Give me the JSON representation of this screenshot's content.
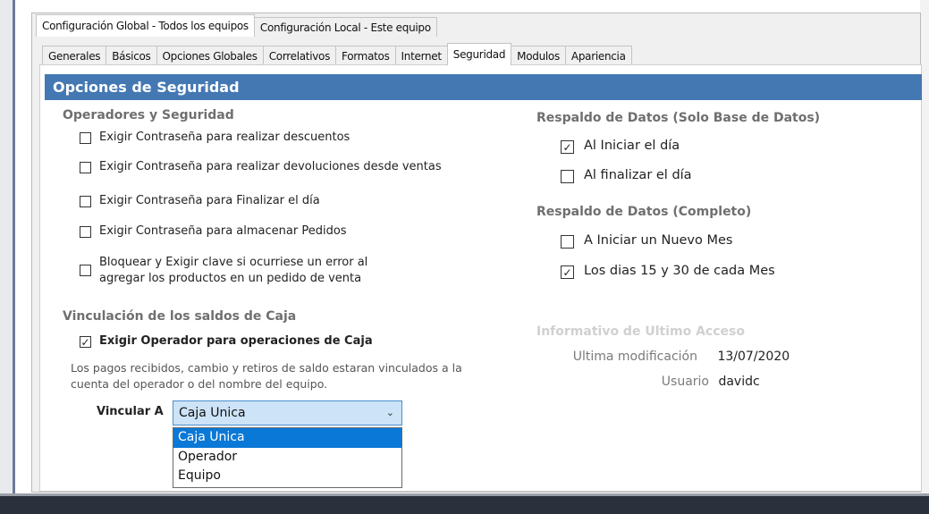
{
  "top_tabs": [
    {
      "label": "Configuración Global - Todos los equipos",
      "active": true
    },
    {
      "label": "Configuración Local - Este equipo",
      "active": false
    }
  ],
  "sub_tabs": [
    {
      "label": "Generales",
      "active": false
    },
    {
      "label": "Básicos",
      "active": false
    },
    {
      "label": "Opciones Globales",
      "active": false
    },
    {
      "label": "Correlativos",
      "active": false
    },
    {
      "label": "Formatos",
      "active": false
    },
    {
      "label": "Internet",
      "active": false
    },
    {
      "label": "Seguridad",
      "active": true
    },
    {
      "label": "Modulos",
      "active": false
    },
    {
      "label": "Apariencia",
      "active": false
    }
  ],
  "section_title": "Opciones de Seguridad",
  "operadores": {
    "title": "Operadores y Seguridad",
    "items": [
      {
        "label": "Exigir Contraseña para realizar descuentos",
        "checked": false
      },
      {
        "label": "Exigir Contraseña para realizar devoluciones desde ventas",
        "checked": false
      },
      {
        "label": "Exigir Contraseña para Finalizar el día",
        "checked": false
      },
      {
        "label": "Exigir Contraseña para almacenar Pedidos",
        "checked": false
      },
      {
        "label": "Bloquear y Exigir clave si ocurriese un error al agregar los productos en un pedido de venta",
        "checked": false
      }
    ]
  },
  "vinculacion": {
    "title": "Vinculación de los saldos de Caja",
    "checkbox_label": "Exigir Operador para operaciones de Caja",
    "checked": true,
    "note": "Los pagos recibidos, cambio y retiros de saldo estaran vinculados a la cuenta del operador o del nombre del equipo.",
    "vincular_label": "Vincular A",
    "selected": "Caja Unica",
    "options": [
      "Caja Unica",
      "Operador",
      "Equipo"
    ]
  },
  "respaldo_bd": {
    "title": "Respaldo de Datos (Solo Base de Datos)",
    "items": [
      {
        "label": "Al Iniciar el día",
        "checked": true
      },
      {
        "label": "Al finalizar el día",
        "checked": false
      }
    ]
  },
  "respaldo_completo": {
    "title": "Respaldo de Datos (Completo)",
    "items": [
      {
        "label": "A Iniciar un Nuevo Mes",
        "checked": false
      },
      {
        "label": "Los dias 15 y 30 de cada Mes",
        "checked": true
      }
    ]
  },
  "informativo": {
    "title": "Informativo de Ultimo Acceso",
    "ultima_mod_label": "Ultima modificación",
    "ultima_mod_value": "13/07/2020",
    "usuario_label": "Usuario",
    "usuario_value": "davidc"
  },
  "colors": {
    "header_blue": "#4478b3",
    "selection_blue": "#0a78d7",
    "combo_blue": "#cde3f7"
  },
  "icons": {
    "check": "✓",
    "chevron": "⌄"
  }
}
